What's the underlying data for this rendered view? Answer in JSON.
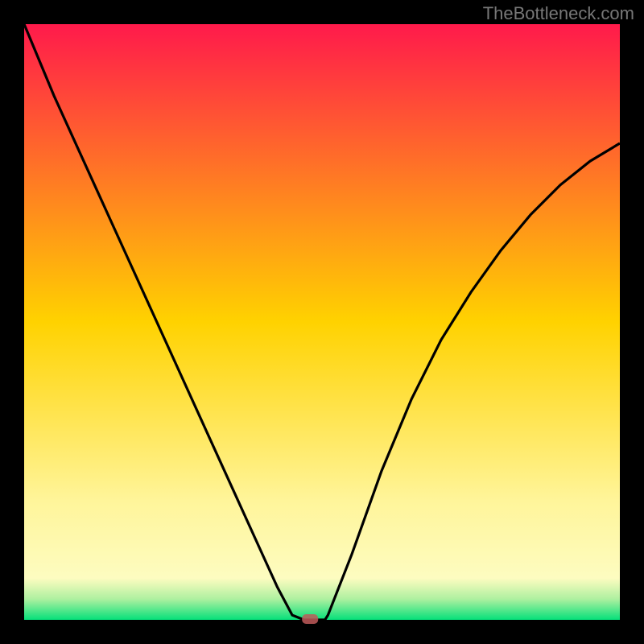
{
  "watermark": "TheBottleneck.com",
  "chart_data": {
    "type": "line",
    "title": "",
    "xlabel": "",
    "ylabel": "",
    "xlim": [
      0,
      100
    ],
    "ylim": [
      0,
      100
    ],
    "x": [
      0,
      5,
      10,
      15,
      20,
      25,
      30,
      35,
      40,
      42.5,
      45,
      47,
      47.5,
      48,
      48.5,
      50.5,
      51,
      55,
      60,
      65,
      70,
      75,
      80,
      85,
      90,
      95,
      100
    ],
    "values": [
      100,
      88,
      77,
      66,
      55,
      44,
      33,
      22,
      11,
      5.5,
      0.8,
      0,
      0,
      0,
      0,
      0,
      0.8,
      11,
      25,
      37,
      47,
      55,
      62,
      68,
      73,
      77,
      80
    ],
    "marker_point": {
      "x": 48,
      "y": 0
    },
    "background_gradient": [
      {
        "stop": 0.0,
        "color": "#ff1a4b"
      },
      {
        "stop": 0.5,
        "color": "#ffd200"
      },
      {
        "stop": 0.8,
        "color": "#fff59a"
      },
      {
        "stop": 0.93,
        "color": "#fdfcc0"
      },
      {
        "stop": 0.965,
        "color": "#aef0a0"
      },
      {
        "stop": 1.0,
        "color": "#05e07a"
      }
    ],
    "black_border_px": 30
  }
}
